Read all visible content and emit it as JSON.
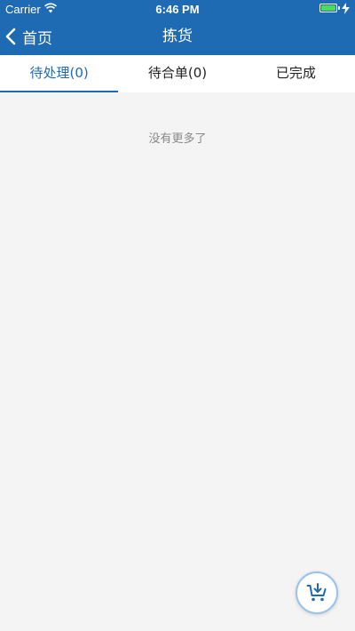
{
  "status_bar": {
    "carrier": "Carrier",
    "time": "6:46 PM",
    "battery_level": 1.0
  },
  "nav": {
    "back_label": "首页",
    "title": "拣货"
  },
  "tabs": [
    {
      "label": "待处理(0)",
      "active": true
    },
    {
      "label": "待合单(0)",
      "active": false
    },
    {
      "label": "已完成",
      "active": false
    }
  ],
  "empty_message": "没有更多了",
  "fab": {
    "icon": "cart-add-icon"
  },
  "colors": {
    "primary": "#1f6bb3",
    "background": "#f4f4f4",
    "muted_text": "#888888"
  }
}
